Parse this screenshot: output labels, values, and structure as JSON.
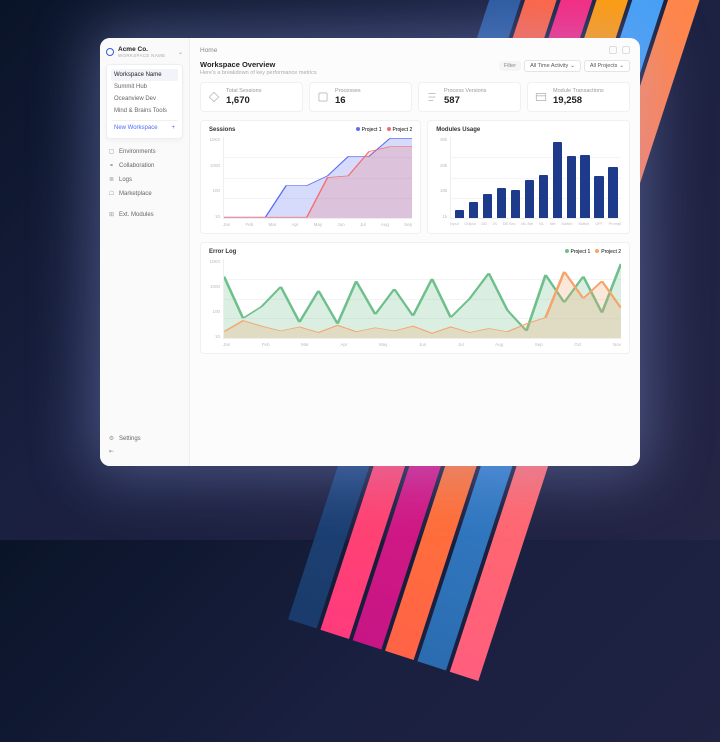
{
  "workspace": {
    "name": "Acme Co.",
    "subtitle": "WORKSPACE NAME",
    "panel": {
      "label": "Workspace Name",
      "items": [
        "Summit Hub",
        "Oceanview Dev",
        "Mind & Brains Tools"
      ],
      "new": "New Workspace"
    }
  },
  "nav": {
    "environments": "Environments",
    "collaboration": "Collaboration",
    "logs": "Logs",
    "marketplace": "Marketplace",
    "ext_modules": "Ext. Modules",
    "settings": "Settings"
  },
  "breadcrumb": "Home",
  "page": {
    "title": "Workspace Overview",
    "subtitle": "Here's a breakdown of key performance metrics"
  },
  "filters": {
    "label": "Filter",
    "activity": "All Time Activity",
    "projects": "All Projects"
  },
  "kpis": [
    {
      "label": "Total Sessions",
      "value": "1,670"
    },
    {
      "label": "Processes",
      "value": "16"
    },
    {
      "label": "Process Versions",
      "value": "587"
    },
    {
      "label": "Module Transactions",
      "value": "19,258"
    }
  ],
  "sessions": {
    "title": "Sessions",
    "legend": [
      "Project 1",
      "Project 2"
    ],
    "colors": [
      "#5b6ef5",
      "#f56b6b"
    ]
  },
  "modules": {
    "title": "Modules Usage"
  },
  "error": {
    "title": "Error Log",
    "legend": [
      "Project 1",
      "Project 2"
    ],
    "colors": [
      "#6dbf8b",
      "#f5a56b"
    ]
  },
  "chart_data": [
    {
      "type": "area",
      "title": "Sessions",
      "categories": [
        "Jan",
        "Feb",
        "Mar",
        "Apr",
        "May",
        "Jun",
        "Jul",
        "Aug",
        "Sep"
      ],
      "ylabel": "",
      "ylim": [
        0,
        10000
      ],
      "yticks": [
        "10K0",
        "1000",
        "100",
        "10"
      ],
      "series": [
        {
          "name": "Project 1",
          "values": [
            12,
            12,
            14,
            450,
            450,
            1200,
            5800,
            5800,
            9800
          ]
        },
        {
          "name": "Project 2",
          "values": [
            10,
            10,
            10,
            10,
            12,
            1000,
            1150,
            6800,
            8800
          ]
        }
      ]
    },
    {
      "type": "bar",
      "title": "Modules Usage",
      "categories": [
        "Input",
        "Output",
        "DB",
        "JS",
        "DB Sec",
        "ML Net",
        "NL",
        "Net",
        "Switch",
        "Switch",
        "GPT",
        "Prompt"
      ],
      "ylabel": "",
      "ylim": [
        0,
        30000
      ],
      "yticks": [
        "30k",
        "20k",
        "10k",
        "1k"
      ],
      "values": [
        3000,
        6000,
        9000,
        11000,
        10500,
        14000,
        16000,
        28000,
        23000,
        23500,
        15500,
        19000
      ]
    },
    {
      "type": "line",
      "title": "Error Log",
      "categories": [
        "Jan",
        "Feb",
        "Mar",
        "Apr",
        "May",
        "Jun",
        "Jul",
        "Aug",
        "Sep",
        "Oct",
        "Nov"
      ],
      "ylabel": "",
      "ylim": [
        0,
        10000
      ],
      "yticks": [
        "10K0",
        "1000",
        "100",
        "10"
      ],
      "series": [
        {
          "name": "Project 1",
          "values": [
            7800,
            2500,
            4000,
            6500,
            2000,
            6000,
            1800,
            7200,
            3000,
            6200,
            2800,
            7500,
            2600,
            5000,
            8200,
            3500,
            900,
            8000,
            4500,
            7800,
            3200,
            9400
          ]
        },
        {
          "name": "Project 2",
          "values": [
            800,
            2200,
            1500,
            900,
            1400,
            700,
            1600,
            800,
            1300,
            900,
            1500,
            600,
            1400,
            700,
            1200,
            800,
            1800,
            2600,
            8400,
            5000,
            7200,
            3800
          ]
        }
      ]
    }
  ]
}
